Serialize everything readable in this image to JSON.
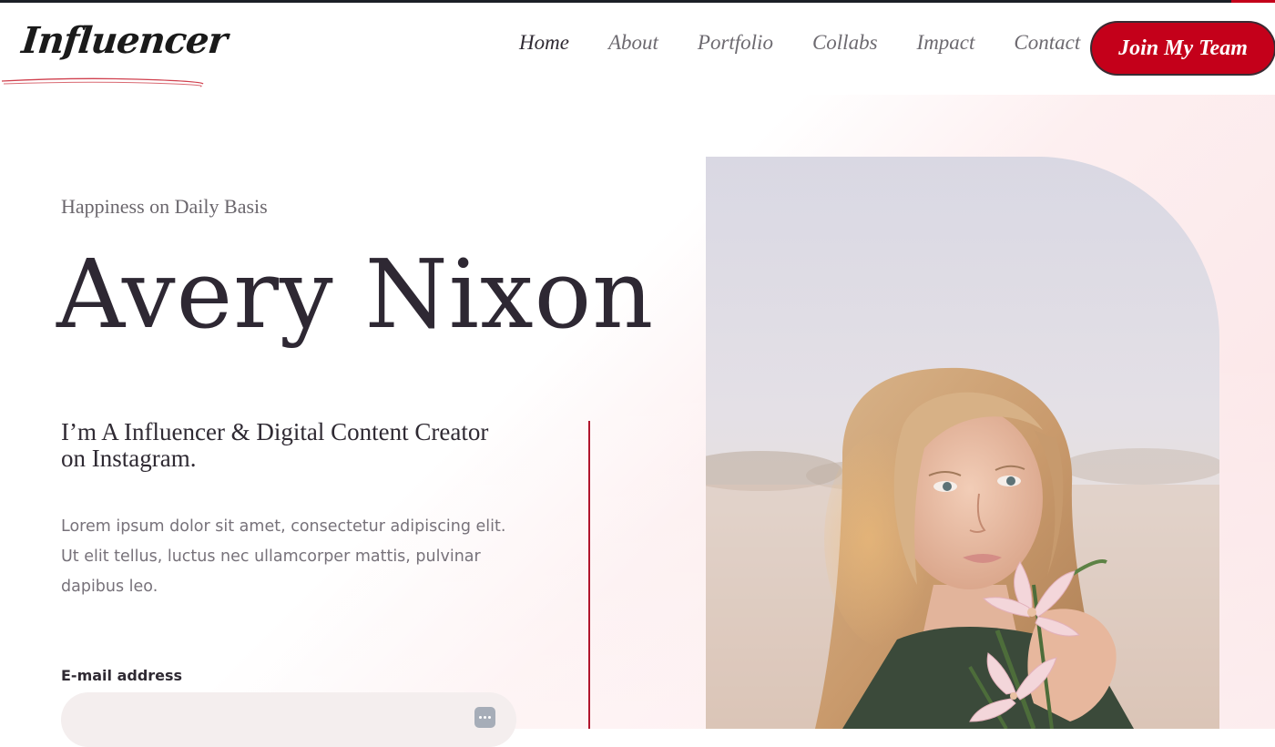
{
  "header": {
    "logo_text": "Influencer",
    "nav": [
      {
        "label": "Home",
        "active": true
      },
      {
        "label": "About",
        "active": false
      },
      {
        "label": "Portfolio",
        "active": false
      },
      {
        "label": "Collabs",
        "active": false
      },
      {
        "label": "Impact",
        "active": false
      },
      {
        "label": "Contact",
        "active": false
      }
    ],
    "cta_label": "Join My Team"
  },
  "hero": {
    "tagline": "Happiness on Daily Basis",
    "name": "Avery Nixon",
    "subheading": "I’m A Influencer & Digital Content Creator on Instagram.",
    "description": "Lorem ipsum dolor sit amet, consectetur adipiscing elit. Ut elit tellus, luctus nec ullamcorper mattis, pulvinar dapibus leo.",
    "email_label": "E-mail address",
    "email_value": "",
    "email_placeholder": ""
  },
  "theme": {
    "accent": "#c4001a",
    "heading": "#2e2833",
    "text_muted": "#77727a"
  },
  "icons": {
    "input_autofill": "more-dots-icon"
  }
}
